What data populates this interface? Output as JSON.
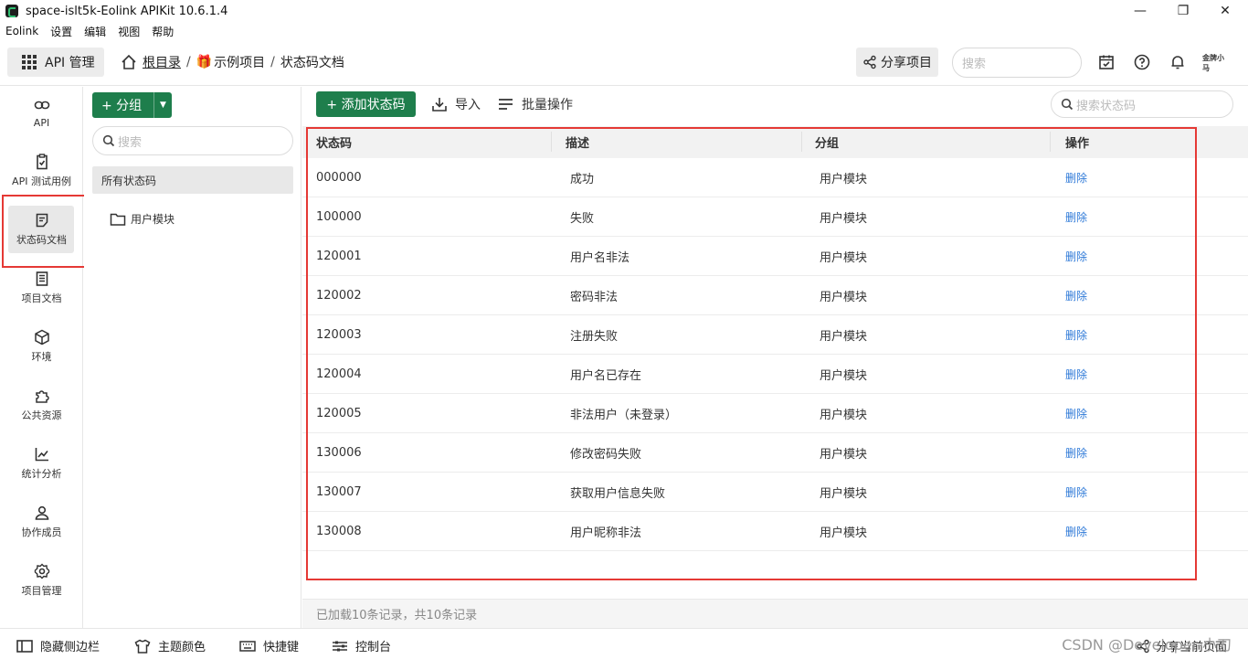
{
  "window": {
    "title": "space-islt5k-Eolink APIKit 10.6.1.4",
    "minimize": "—",
    "maximize": "❐",
    "close": "✕"
  },
  "menu": [
    "Eolink",
    "设置",
    "编辑",
    "视图",
    "帮助"
  ],
  "header": {
    "api_manage": "API 管理",
    "breadcrumb": {
      "root": "根目录",
      "project": "示例项目",
      "current": "状态码文档",
      "sep": "/"
    },
    "share_project": "分享项目",
    "search_placeholder": "搜索",
    "avatar_text": "金牌小马"
  },
  "sidebar": {
    "items": [
      {
        "label": "API",
        "icon": "link-icon"
      },
      {
        "label": "API 测试用例",
        "icon": "clipboard-check-icon"
      },
      {
        "label": "状态码文档",
        "icon": "document-icon",
        "active": true
      },
      {
        "label": "项目文档",
        "icon": "notebook-icon"
      },
      {
        "label": "环境",
        "icon": "cube-icon"
      },
      {
        "label": "公共资源",
        "icon": "puzzle-icon"
      },
      {
        "label": "统计分析",
        "icon": "chart-icon"
      },
      {
        "label": "协作成员",
        "icon": "user-icon"
      },
      {
        "label": "项目管理",
        "icon": "gear-icon"
      }
    ]
  },
  "groups": {
    "add_group": "+ 分组",
    "search_placeholder": "搜索",
    "all_codes": "所有状态码",
    "folders": [
      "用户模块"
    ]
  },
  "toolbar": {
    "add_code": "+ 添加状态码",
    "import": "导入",
    "batch": "批量操作",
    "search_placeholder": "搜索状态码"
  },
  "table": {
    "columns": [
      "状态码",
      "描述",
      "分组",
      "操作"
    ],
    "rows": [
      {
        "code": "000000",
        "desc": "成功",
        "group": "用户模块",
        "action": "删除"
      },
      {
        "code": "100000",
        "desc": "失败",
        "group": "用户模块",
        "action": "删除"
      },
      {
        "code": "120001",
        "desc": "用户名非法",
        "group": "用户模块",
        "action": "删除"
      },
      {
        "code": "120002",
        "desc": "密码非法",
        "group": "用户模块",
        "action": "删除"
      },
      {
        "code": "120003",
        "desc": "注册失败",
        "group": "用户模块",
        "action": "删除"
      },
      {
        "code": "120004",
        "desc": "用户名已存在",
        "group": "用户模块",
        "action": "删除"
      },
      {
        "code": "120005",
        "desc": "非法用户（未登录）",
        "group": "用户模块",
        "action": "删除"
      },
      {
        "code": "130006",
        "desc": "修改密码失败",
        "group": "用户模块",
        "action": "删除"
      },
      {
        "code": "130007",
        "desc": "获取用户信息失败",
        "group": "用户模块",
        "action": "删除"
      },
      {
        "code": "130008",
        "desc": "用户昵称非法",
        "group": "用户模块",
        "action": "删除"
      }
    ],
    "status": "已加载10条记录，共10条记录"
  },
  "bottombar": {
    "hide_sidebar": "隐藏侧边栏",
    "theme": "主题颜色",
    "shortcuts": "快捷键",
    "console": "控制台",
    "share_page": "分享当前页面"
  },
  "watermark": "CSDN @Developer-小刀",
  "colors": {
    "primary_green": "#1e7e4c",
    "link_blue": "#2f7ad8",
    "highlight_red": "#e53935"
  }
}
